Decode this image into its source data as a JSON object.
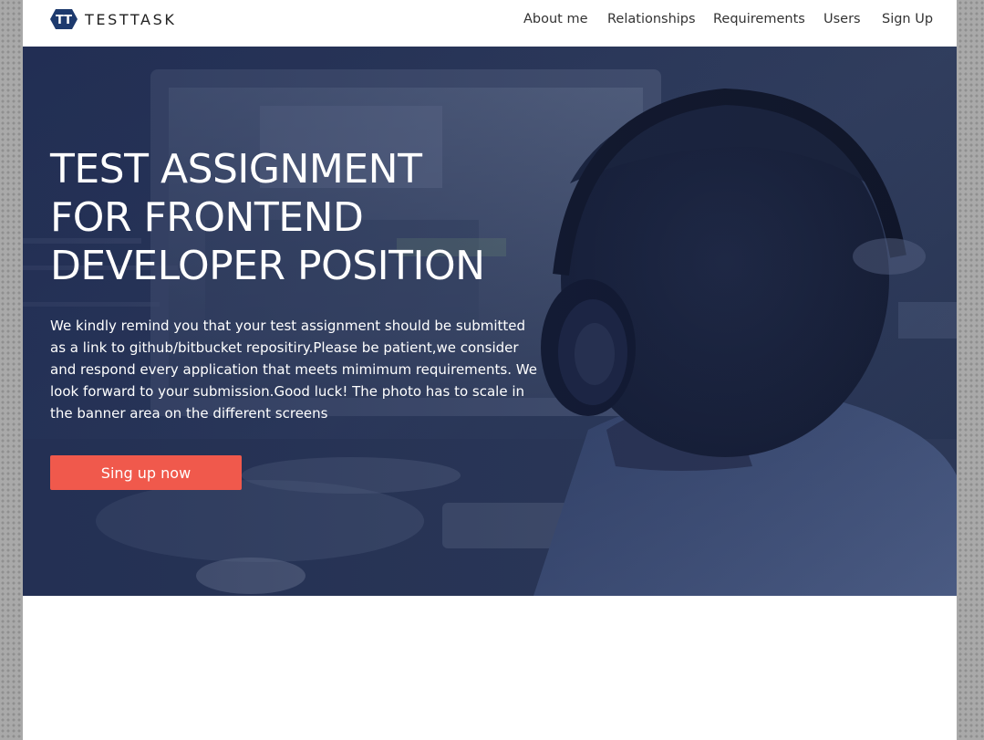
{
  "brand": {
    "logo_letters": "TT",
    "name": "TESTTASK"
  },
  "nav": {
    "items": [
      {
        "label": "About me"
      },
      {
        "label": "Relationships"
      },
      {
        "label": "Requirements"
      },
      {
        "label": "Users"
      },
      {
        "label": "Sign Up"
      }
    ]
  },
  "hero": {
    "title_lines": [
      "TEST ASSIGNMENT",
      "FOR FRONTEND",
      "DEVELOPER POSITION"
    ],
    "description": "We kindly remind you that your test assignment should be submitted as a link to github/bitbucket repositiry.Please be patient,we consider and respond every application that meets mimimum requirements. We look forward to your submission.Good luck! The photo has to scale in the banner area on the different screens",
    "cta_label": "Sing up now"
  },
  "colors": {
    "accent": "#f0594c",
    "hero_overlay": "#1f2c55",
    "logo": "#1d3a6e"
  }
}
